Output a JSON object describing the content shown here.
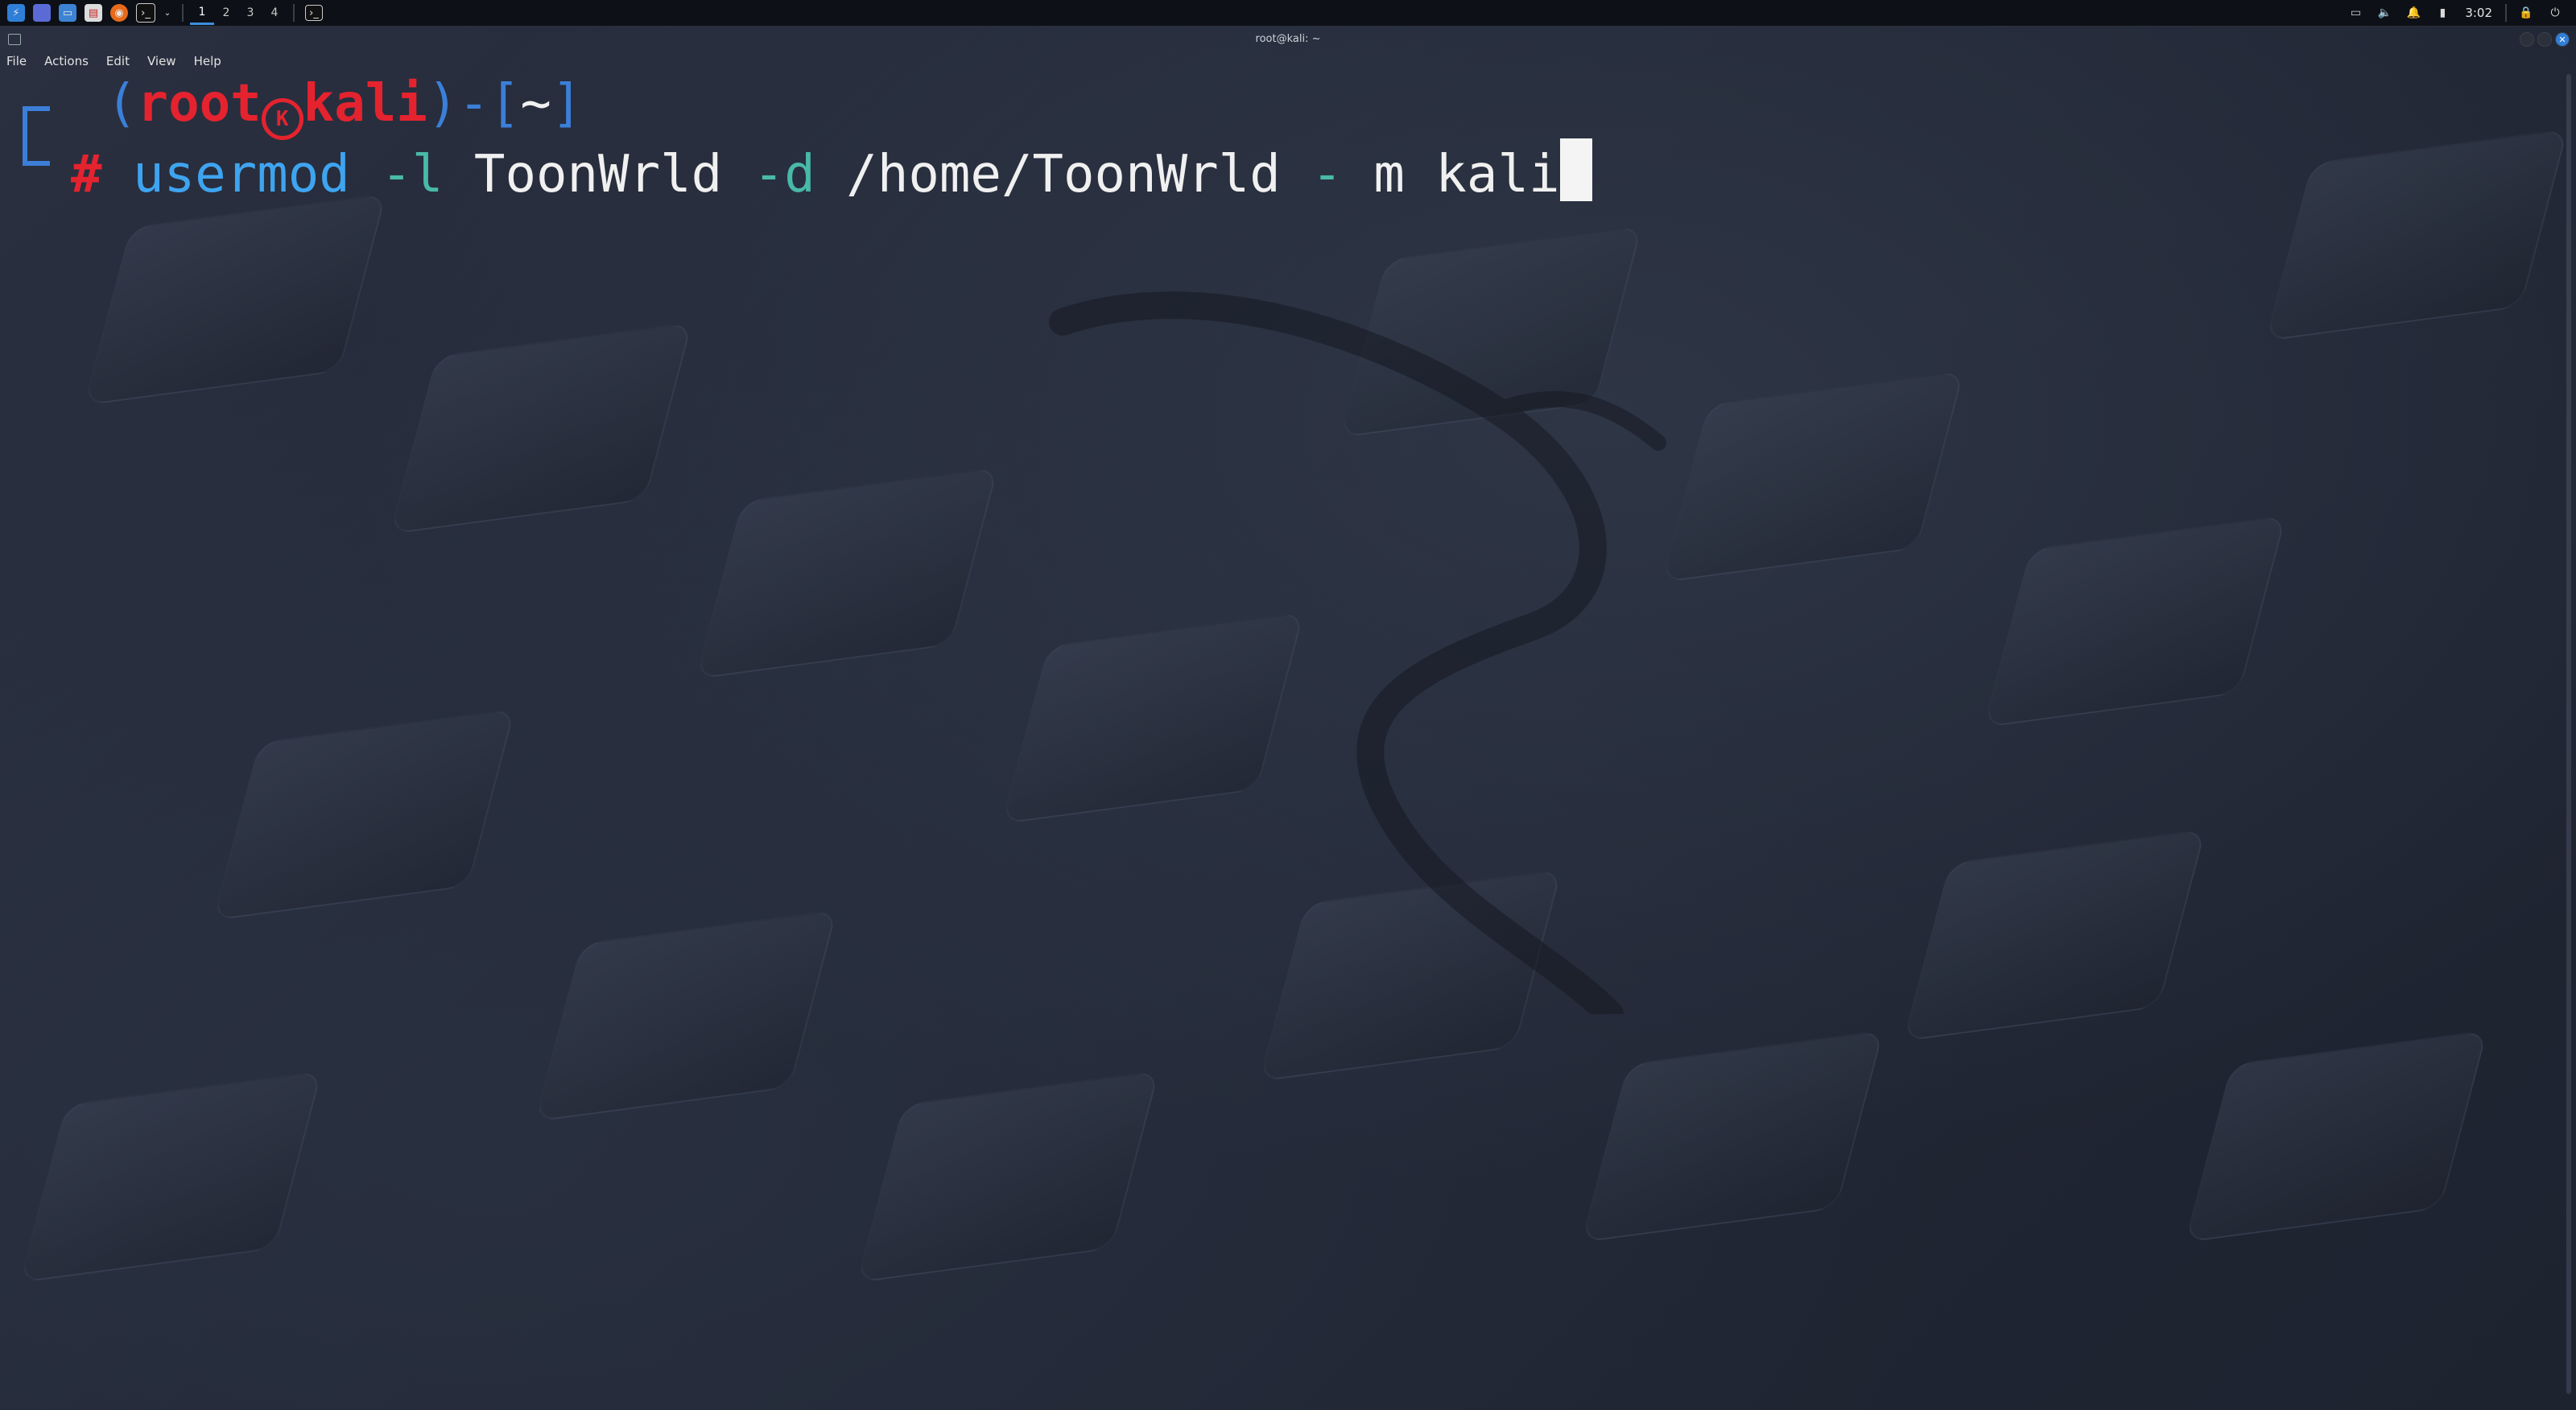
{
  "taskbar": {
    "workspaces": [
      "1",
      "2",
      "3",
      "4"
    ],
    "active_workspace": "1",
    "clock": "3:02",
    "icons": [
      "kali-menu-icon",
      "desktop-icon",
      "file-manager-icon",
      "text-editor-icon",
      "firefox-icon",
      "terminal-icon",
      "dropdown-chevron-icon"
    ],
    "tray_icons": [
      "display-icon",
      "volume-icon",
      "notification-bell-icon",
      "battery-icon",
      "lock-icon",
      "power-icon"
    ]
  },
  "window": {
    "title": "root@kali: ~",
    "menu": {
      "file": "File",
      "actions": "Actions",
      "edit": "Edit",
      "view": "View",
      "help": "Help"
    }
  },
  "terminal": {
    "prompt": {
      "open_paren": "(",
      "user": "root",
      "host": "kali",
      "close_paren_dash": ")-[",
      "dir": "~",
      "close_bracket": "]",
      "symbol": "#"
    },
    "command": {
      "program": "usermod",
      "flag_l": "-l",
      "arg_user": "ToonWrld",
      "flag_d": "-d",
      "arg_dir": "/home/ToonWrld",
      "dash": "-",
      "m": "m",
      "arg_old": "kali"
    }
  },
  "colors": {
    "prompt_blue": "#3b7fd9",
    "prompt_red": "#e4232f",
    "command_blue": "#3fa4f0",
    "option_teal": "#49b9a8",
    "accent": "#2f7fd8"
  }
}
